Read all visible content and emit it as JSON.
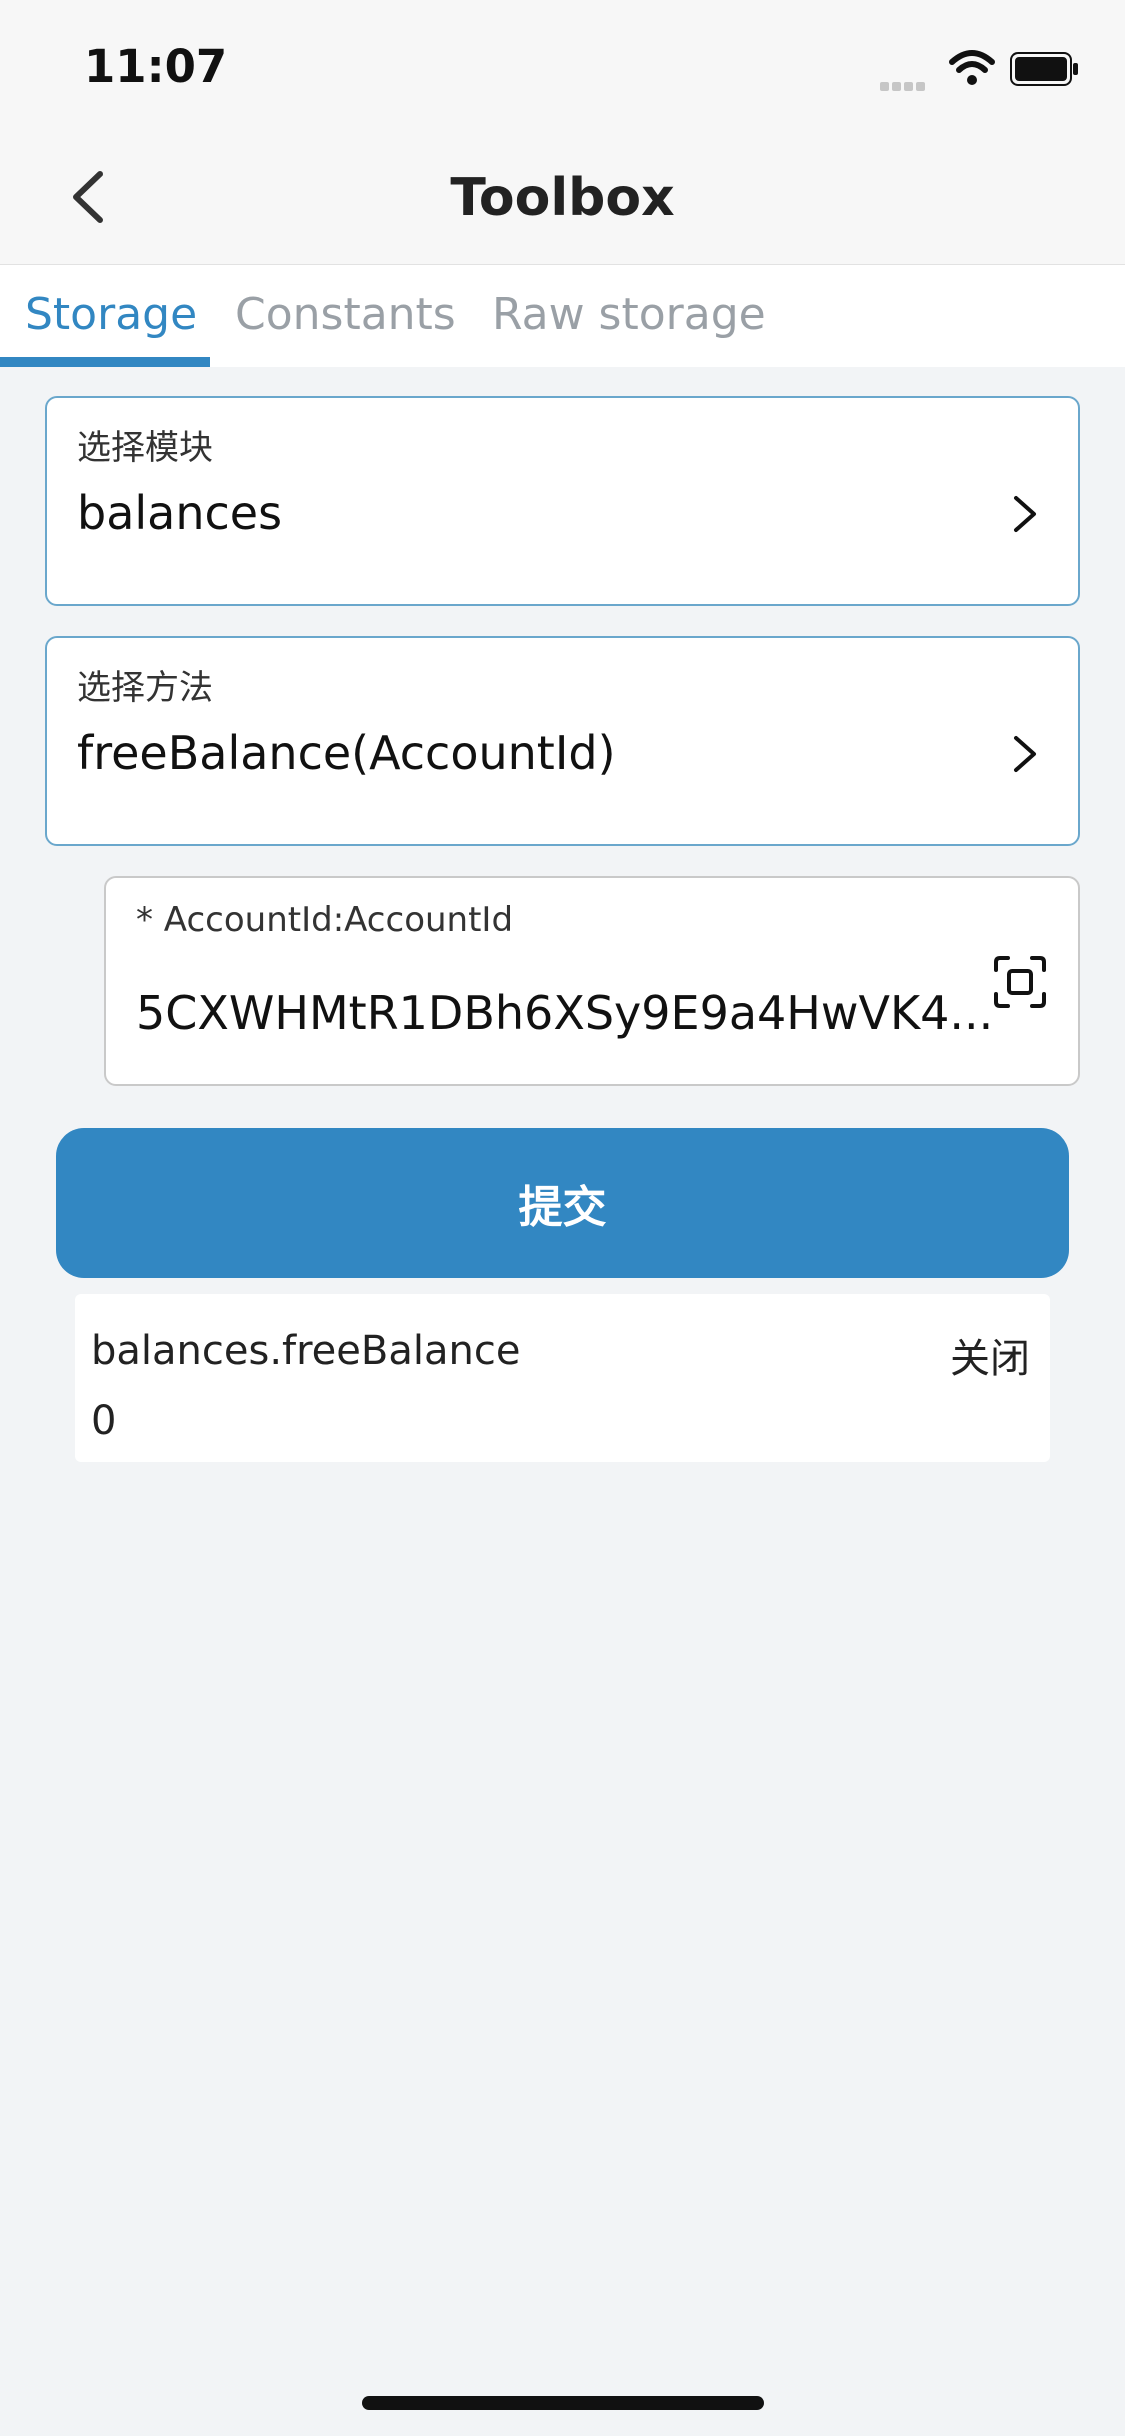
{
  "status_bar": {
    "time": "11:07"
  },
  "nav": {
    "title": "Toolbox",
    "back_icon": "chevron-left-icon"
  },
  "tabs": [
    {
      "label": "Storage",
      "active": true
    },
    {
      "label": "Constants",
      "active": false
    },
    {
      "label": "Raw storage",
      "active": false
    }
  ],
  "form": {
    "module": {
      "label": "选择模块",
      "value": "balances"
    },
    "method": {
      "label": "选择方法",
      "value": "freeBalance(AccountId)"
    },
    "account": {
      "label": "* AccountId:AccountId",
      "value": "5CXWHMtR1DBh6XSy9E9a4HwVK4..."
    }
  },
  "submit_label": "提交",
  "result": {
    "title": "balances.freeBalance",
    "close_label": "关闭",
    "value": "0"
  },
  "colors": {
    "accent": "#3287c2",
    "background": "#f2f4f6"
  }
}
